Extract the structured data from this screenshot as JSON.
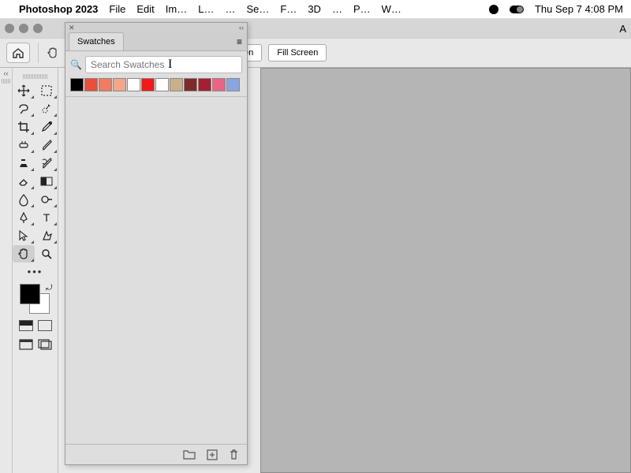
{
  "menubar": {
    "app": "Photoshop 2023",
    "items": [
      "File",
      "Edit",
      "Im…",
      "L…",
      "…",
      "Se…",
      "F…",
      "3D",
      "…",
      "P…",
      "W…"
    ],
    "datetime": "Thu Sep 7  4:08 PM"
  },
  "optionsbar": {
    "btn_right1": "een",
    "btn_right2": "Fill Screen"
  },
  "swatches": {
    "title": "Swatches",
    "search_placeholder": "Search Swatches",
    "colors": [
      "#000000",
      "#e94f3a",
      "#f07b5f",
      "#f4a58c",
      "#ffffff",
      "#f01a1a",
      "#ffffff",
      "#c7b08a",
      "#7d2a2a",
      "#a31f33",
      "#eb6487",
      "#8aa6e0"
    ]
  },
  "window_letter": "A"
}
